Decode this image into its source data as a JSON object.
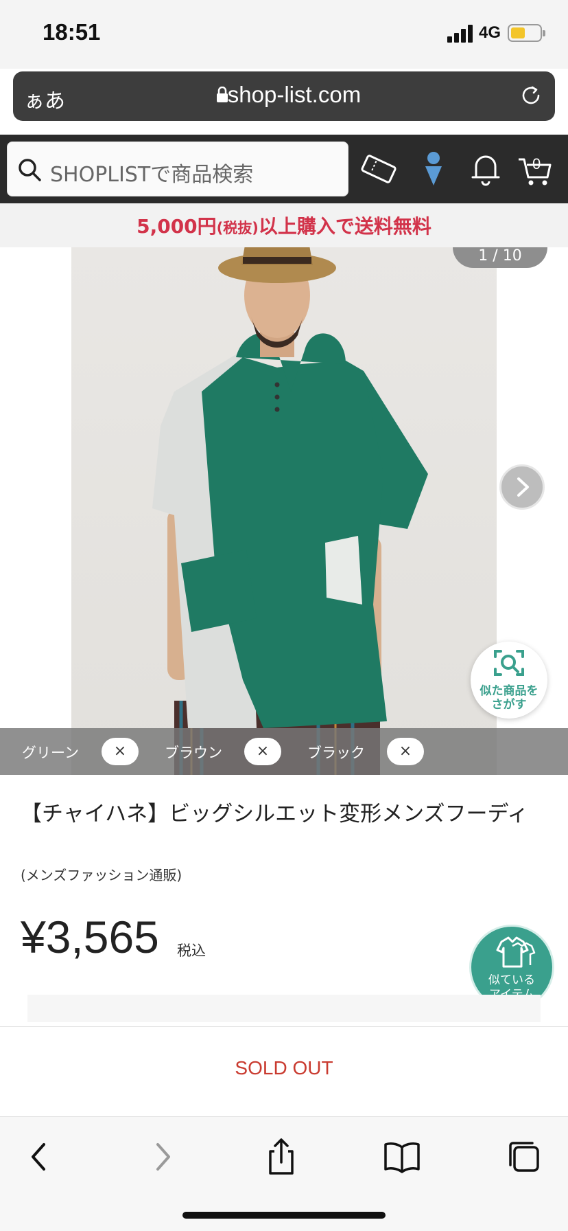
{
  "status_bar": {
    "time": "18:51",
    "network": "4G"
  },
  "browser": {
    "text_size_label": "ぁあ",
    "url": "shop-list.com"
  },
  "header": {
    "search_placeholder": "SHOPLISTで商品検索",
    "cart_count": "0"
  },
  "promo": {
    "amount": "5,000円",
    "note": "(税抜)",
    "text": "以上購入で送料無料"
  },
  "gallery": {
    "counter": "1 / 10",
    "similar_search_label_1": "似た商品を",
    "similar_search_label_2": "さがす",
    "colors": [
      {
        "name": "グリーン"
      },
      {
        "name": "ブラウン"
      },
      {
        "name": "ブラック"
      }
    ],
    "remove_symbol": "×"
  },
  "product": {
    "title": "【チャイハネ】ビッグシルエット変形メンズフーディ",
    "category": "(メンズファッション通販)",
    "price": "¥3,565",
    "tax_label": "税込",
    "similar_items_label_1": "似ている",
    "similar_items_label_2": "アイテム"
  },
  "purchase": {
    "sold_out_label": "SOLD OUT"
  },
  "colors": {
    "accent_red": "#d2334a",
    "teal": "#3aa08d",
    "soldout_red": "#c93a2f",
    "header_dark": "#2b2b2b"
  }
}
